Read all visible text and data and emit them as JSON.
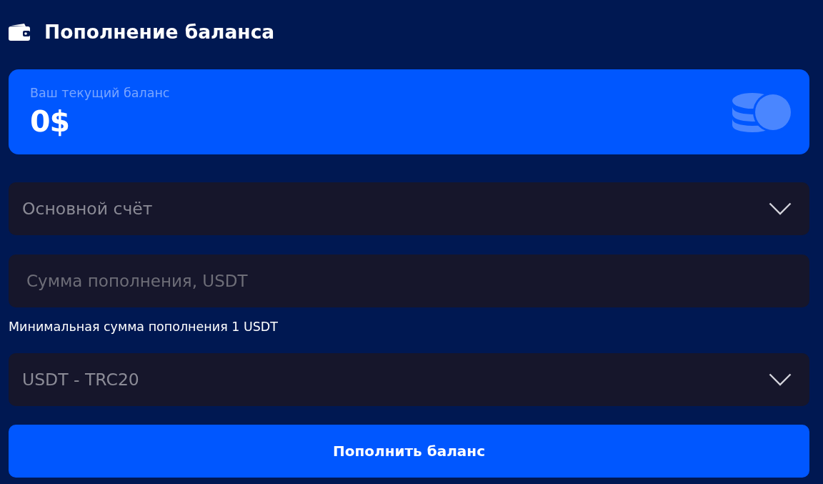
{
  "header": {
    "title": "Пополнение баланса"
  },
  "balance_card": {
    "label": "Ваш текущий баланс",
    "amount": "0$"
  },
  "form": {
    "fields": [
      {
        "kind": "select",
        "value": "Основной счёт"
      },
      {
        "kind": "input",
        "placeholder": "Сумма пополнения, USDT",
        "hint": "Минимальная сумма пополнения 1 USDT"
      },
      {
        "kind": "select",
        "value": "USDT - TRC20"
      }
    ]
  },
  "submit_button": {
    "label": "Пополнить баланс"
  }
}
